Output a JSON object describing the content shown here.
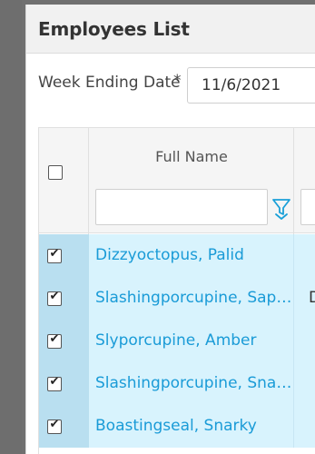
{
  "panel": {
    "title": "Employees List",
    "week_ending": {
      "label": "Week Ending Date",
      "required_mark": "*",
      "value": "11/6/2021"
    }
  },
  "grid": {
    "columns": [
      {
        "key": "select",
        "label": ""
      },
      {
        "key": "full_name",
        "label": "Full Name"
      },
      {
        "key": "next",
        "label": ""
      }
    ],
    "header_checkbox_checked": false,
    "filter": {
      "full_name_value": "",
      "icon": "filter-icon"
    },
    "rows": [
      {
        "checked": true,
        "full_name": "Dizzyoctopus, Palid",
        "extra": ""
      },
      {
        "checked": true,
        "full_name": "Slashingporcupine, Sap…",
        "extra": "D"
      },
      {
        "checked": true,
        "full_name": "Slyporcupine, Amber",
        "extra": ""
      },
      {
        "checked": true,
        "full_name": "Slashingporcupine, Sna…",
        "extra": ""
      },
      {
        "checked": true,
        "full_name": "Boastingseal, Snarky",
        "extra": ""
      }
    ],
    "colors": {
      "row_background": "#d8f3fd",
      "select_column_background": "#b9dff0",
      "name_link_color": "#1a9bd7",
      "filter_icon_color": "#1aa0d8"
    }
  }
}
